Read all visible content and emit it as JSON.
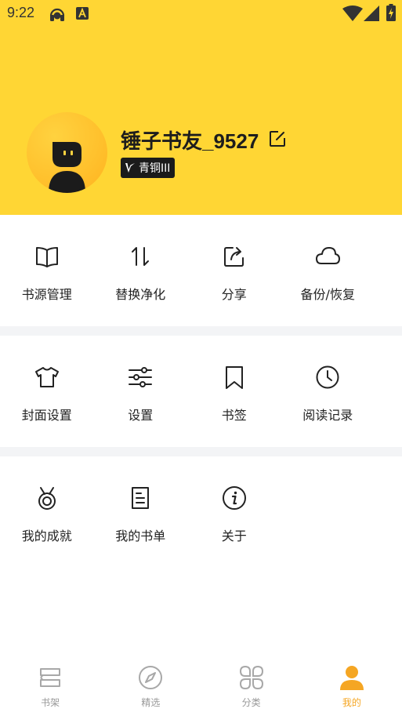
{
  "status_bar": {
    "time": "9:22"
  },
  "profile": {
    "username": "锤子书友_9527",
    "level": "青铜III"
  },
  "menu_rows": [
    [
      {
        "label": "书源管理",
        "icon": "book-open-icon"
      },
      {
        "label": "替换净化",
        "icon": "swap-vertical-icon"
      },
      {
        "label": "分享",
        "icon": "share-icon"
      },
      {
        "label": "备份/恢复",
        "icon": "cloud-icon"
      }
    ],
    [
      {
        "label": "封面设置",
        "icon": "shirt-icon"
      },
      {
        "label": "设置",
        "icon": "sliders-icon"
      },
      {
        "label": "书签",
        "icon": "bookmark-icon"
      },
      {
        "label": "阅读记录",
        "icon": "clock-icon"
      }
    ],
    [
      {
        "label": "我的成就",
        "icon": "medal-icon"
      },
      {
        "label": "我的书单",
        "icon": "booklist-icon"
      },
      {
        "label": "关于",
        "icon": "info-icon"
      }
    ]
  ],
  "tabbar": {
    "tabs": [
      {
        "label": "书架",
        "icon": "bookshelf-icon"
      },
      {
        "label": "精选",
        "icon": "compass-icon"
      },
      {
        "label": "分类",
        "icon": "category-icon"
      },
      {
        "label": "我的",
        "icon": "person-icon",
        "active": true
      }
    ]
  },
  "colors": {
    "header": "#FFD634",
    "accent": "#F5A623",
    "separator": "#F3F4F6"
  }
}
